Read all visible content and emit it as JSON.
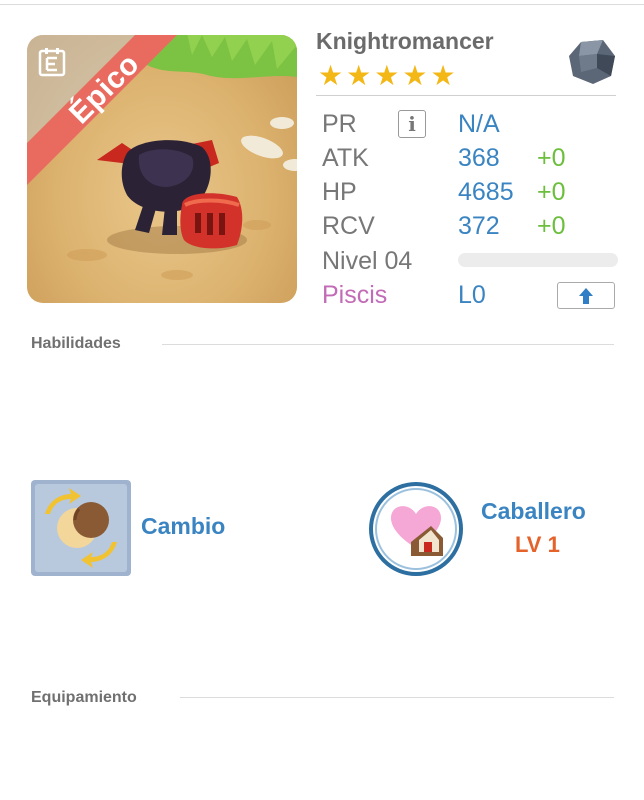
{
  "monster": {
    "name": "Knightromancer",
    "rarity": "Épico",
    "stars": 5,
    "star_glyph": "★",
    "element_icon": "stone-element-icon",
    "zodiac_icon": "pisces-icon",
    "zodiac_glyph": "♓"
  },
  "stats": {
    "pr": {
      "label": "PR",
      "value": "N/A",
      "info_glyph": "i"
    },
    "atk": {
      "label": "ATK",
      "value": "368",
      "bonus": "+0"
    },
    "hp": {
      "label": "HP",
      "value": "4685",
      "bonus": "+0"
    },
    "rcv": {
      "label": "RCV",
      "value": "372",
      "bonus": "+0"
    },
    "level": {
      "label": "Nivel 04",
      "progress": 0
    },
    "zodiac": {
      "label": "Piscis",
      "value": "L0"
    }
  },
  "sections": {
    "skills": "Habilidades",
    "equipment": "Equipamiento"
  },
  "skills": [
    {
      "name": "Cambio",
      "icon": "swap-orbs-icon"
    },
    {
      "name": "Caballero",
      "level": "LV 1",
      "icon": "heart-house-icon"
    }
  ],
  "colors": {
    "rarity_ribbon": "#e96a5e",
    "stat_value": "#3a84c2",
    "bonus": "#6cbf3c",
    "zodiac": "#c26bb6",
    "skill_level": "#e5622b",
    "star": "#f3b716"
  }
}
